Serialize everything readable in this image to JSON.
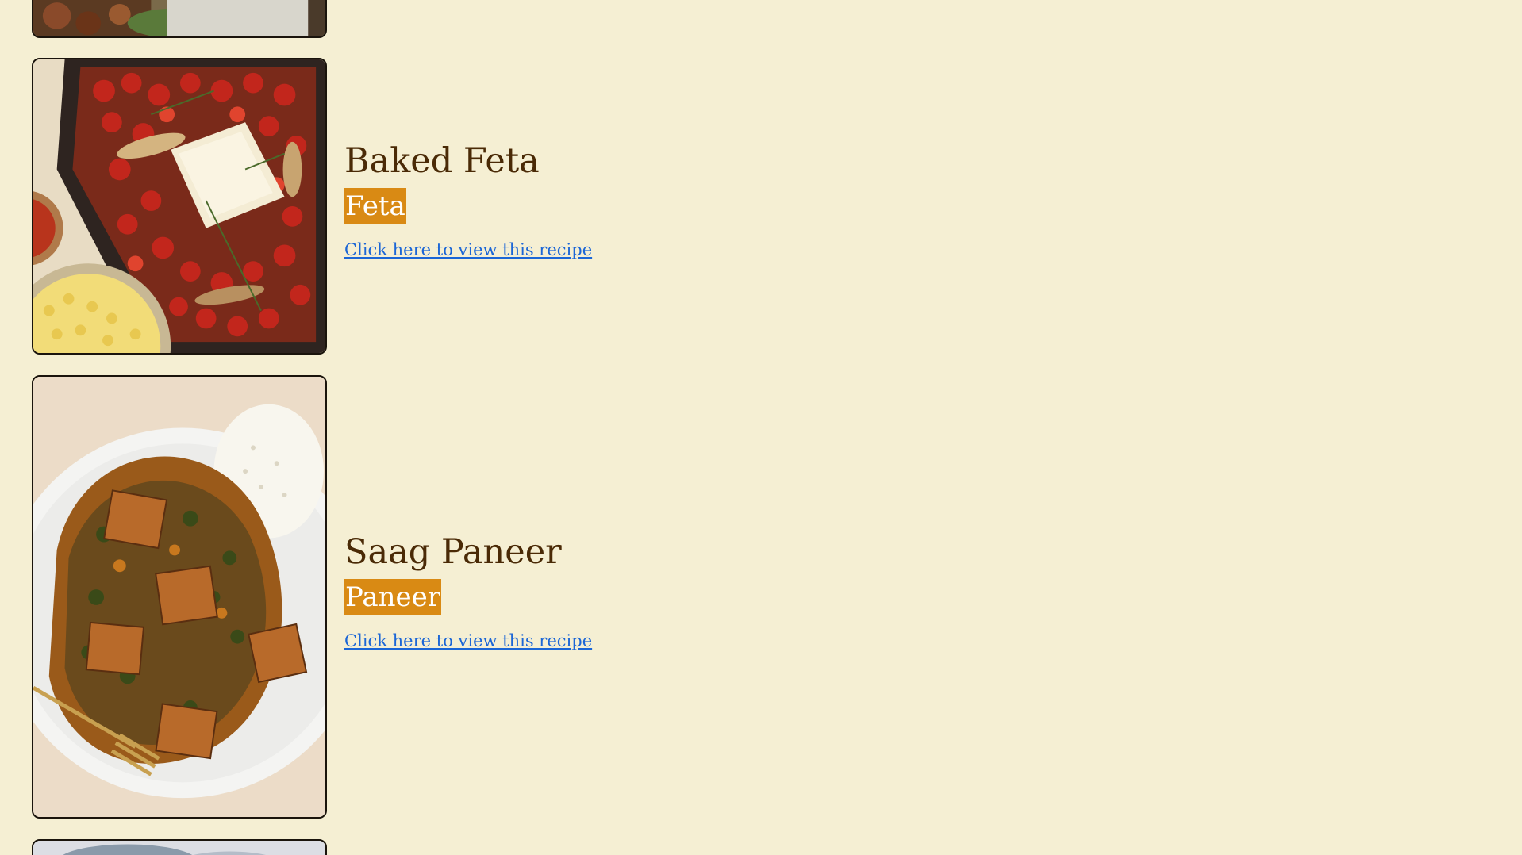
{
  "recipes": [
    {
      "title": "Baked Feta",
      "ingredient": "Feta",
      "link_text": "Click here to view this recipe"
    },
    {
      "title": "Saag Paneer",
      "ingredient": "Paneer",
      "link_text": "Click here to view this recipe"
    }
  ],
  "colors": {
    "background": "#f5efd3",
    "title": "#4a2a06",
    "tag_bg": "#d98a14",
    "link": "#1b66d6"
  }
}
